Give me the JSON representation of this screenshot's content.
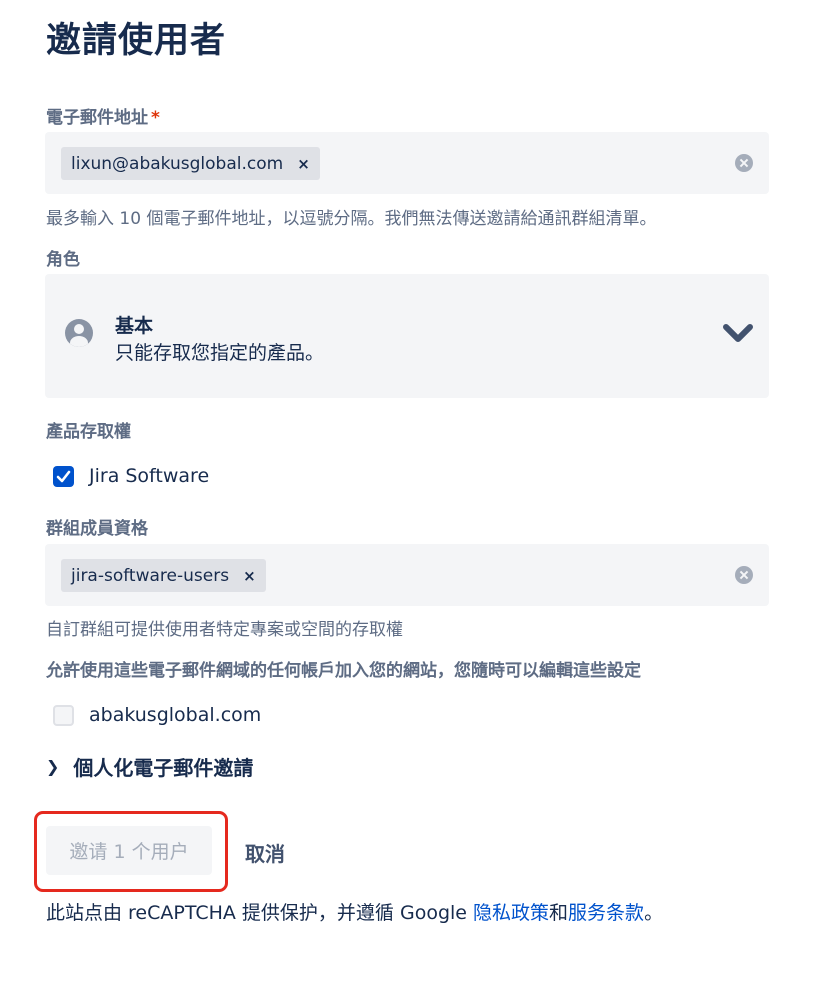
{
  "page_title": "邀請使用者",
  "email": {
    "label": "電子郵件地址",
    "required_mark": "*",
    "chip": "lixun@abakusglobal.com",
    "chip_remove": "×",
    "helper": "最多輸入 10 個電子郵件地址，以逗號分隔。我們無法傳送邀請給通訊群組清單。"
  },
  "role": {
    "label": "角色",
    "selected_title": "基本",
    "selected_desc": "只能存取您指定的產品。"
  },
  "product_access": {
    "label": "產品存取權",
    "items": [
      {
        "label": "Jira Software",
        "checked": true
      }
    ]
  },
  "groups": {
    "label": "群組成員資格",
    "chip": "jira-software-users",
    "chip_remove": "×",
    "helper": "自訂群組可提供使用者特定專案或空間的存取權"
  },
  "domain_access": {
    "label": "允許使用這些電子郵件網域的任何帳戶加入您的網站，您隨時可以編輯這些設定",
    "items": [
      {
        "label": "abakusglobal.com",
        "checked": false
      }
    ]
  },
  "personalize": {
    "label": "個人化電子郵件邀請"
  },
  "actions": {
    "invite": "邀请 1 个用户",
    "cancel": "取消"
  },
  "footer": {
    "prefix": "此站点由 reCAPTCHA 提供保护，并遵循 Google ",
    "privacy": "隐私政策",
    "and": "和",
    "terms": "服务条款",
    "suffix": "。"
  },
  "colors": {
    "primary": "#0052cc",
    "text": "#172b4d",
    "subtle": "#5e6c84",
    "field_bg": "#f4f5f7",
    "annotation_red": "#e5291e"
  },
  "icons": [
    "remove-chip-icon",
    "clear-field-icon",
    "user-avatar-icon",
    "chevron-down-icon",
    "checkbox-checked-icon",
    "chevron-right-icon"
  ]
}
